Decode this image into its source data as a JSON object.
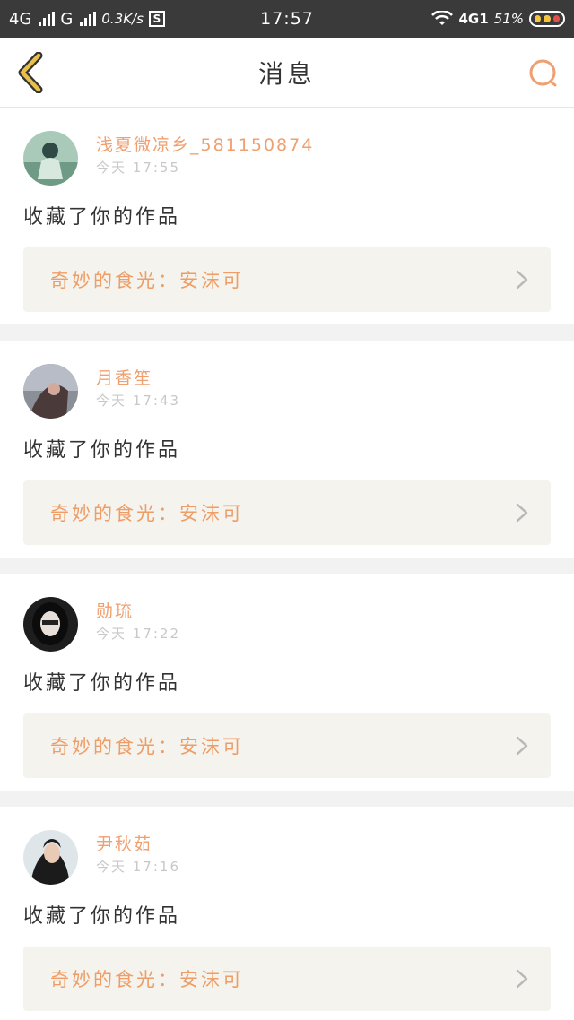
{
  "status_bar": {
    "net1": "4G",
    "net2": "G",
    "speed": "0.3K/s",
    "s_badge": "S",
    "time": "17:57",
    "net3": "4G1",
    "battery": "51%"
  },
  "header": {
    "title": "消息",
    "back_icon": "chevron-left-icon",
    "search_icon": "search-icon",
    "accent_back": "#e8c04a",
    "accent_search": "#f0a070"
  },
  "messages": [
    {
      "username": "浅夏微凉乡_581150874",
      "time": "今天 17:55",
      "action": "收藏了你的作品",
      "work_title": "奇妙的食光：安沫可"
    },
    {
      "username": "月香笙",
      "time": "今天 17:43",
      "action": "收藏了你的作品",
      "work_title": "奇妙的食光：安沫可"
    },
    {
      "username": "勋琉",
      "time": "今天 17:22",
      "action": "收藏了你的作品",
      "work_title": "奇妙的食光：安沫可"
    },
    {
      "username": "尹秋茹",
      "time": "今天 17:16",
      "action": "收藏了你的作品",
      "work_title": "奇妙的食光：安沫可"
    }
  ],
  "colors": {
    "username": "#f0a070",
    "work_title": "#ee9d66",
    "link_bg": "#f4f3ee"
  }
}
